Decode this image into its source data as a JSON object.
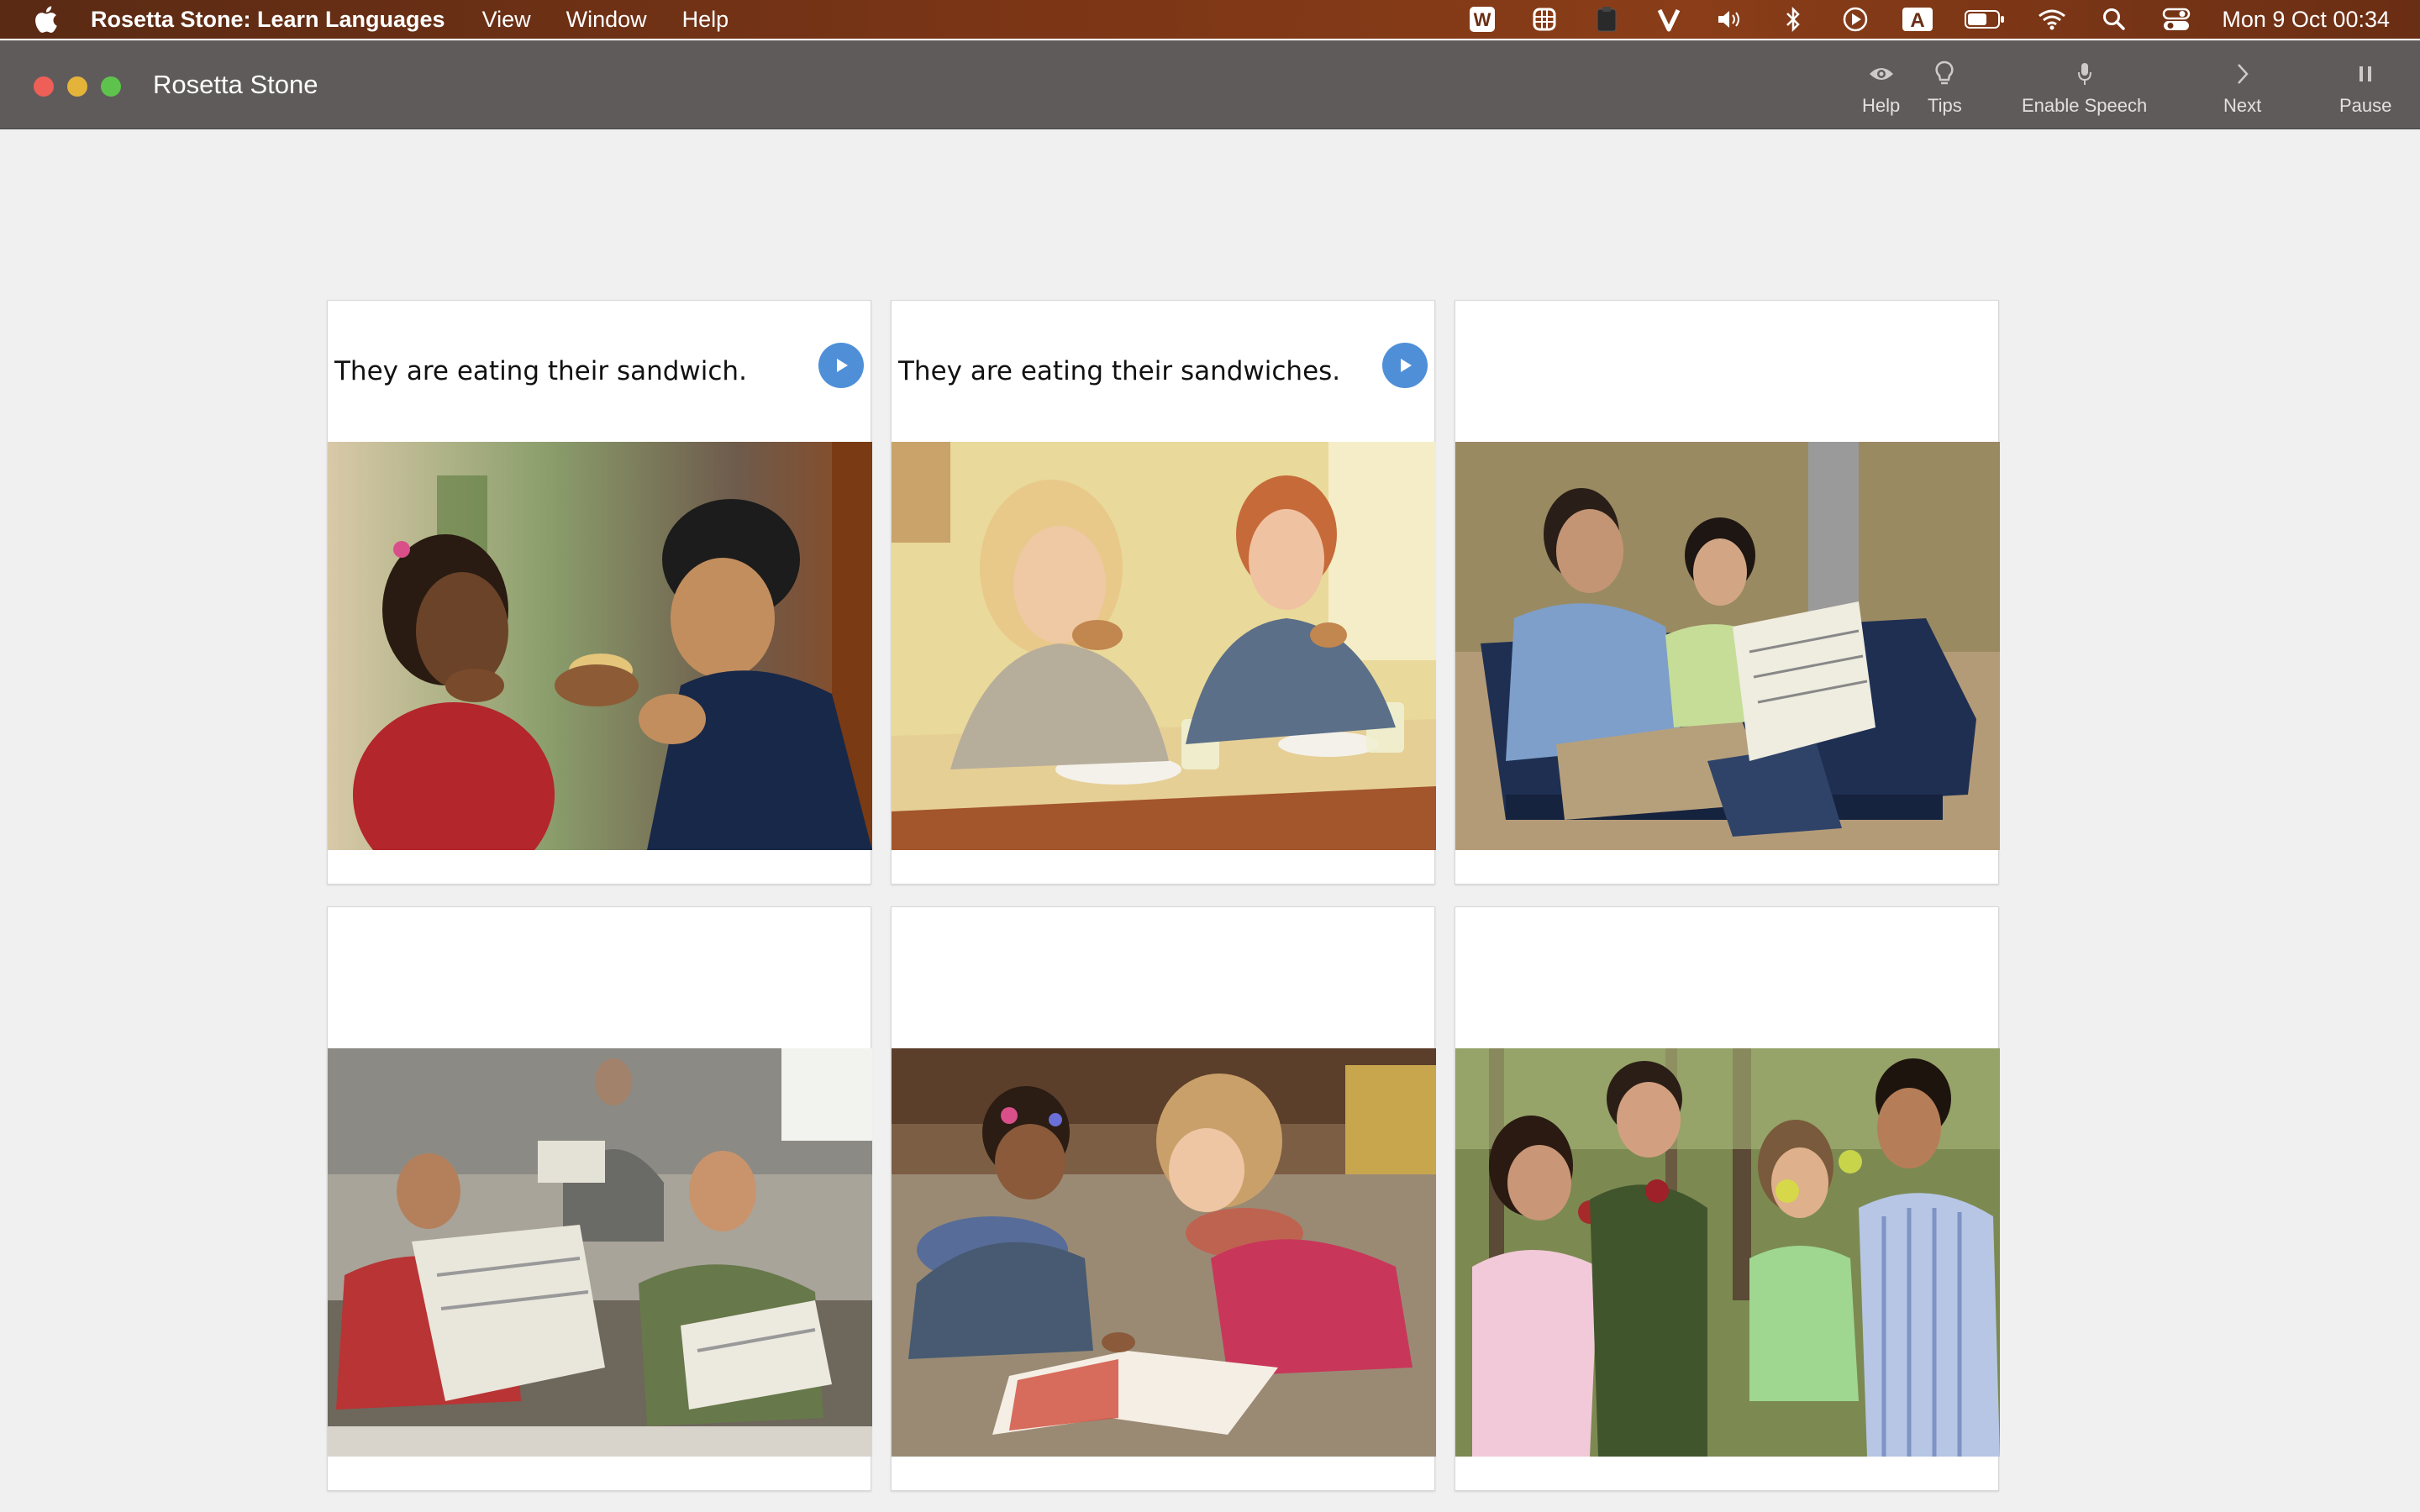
{
  "menubar": {
    "app_name": "Rosetta Stone: Learn Languages",
    "items": [
      "View",
      "Window",
      "Help"
    ],
    "status_icons": [
      "word-icon",
      "grid-icon",
      "clipboard-icon",
      "vivaldi-icon",
      "volume-icon",
      "bluetooth-icon",
      "play-circle-icon",
      "keyboard-input-icon",
      "battery-icon",
      "wifi-icon",
      "spotlight-search-icon",
      "control-center-icon"
    ],
    "input_source_label": "A",
    "clock": "Mon 9 Oct  00:34"
  },
  "window": {
    "title": "Rosetta Stone",
    "toolbar": {
      "help": "Help",
      "tips": "Tips",
      "speech": "Enable Speech",
      "next": "Next",
      "pause": "Pause"
    }
  },
  "cards": [
    {
      "caption": "They are eating their sandwich.",
      "has_audio": true,
      "photo": "girl and boy eating sandwich"
    },
    {
      "caption": "They are eating their sandwiches.",
      "has_audio": true,
      "photo": "two girls eating sandwiches at table"
    },
    {
      "caption": "",
      "has_audio": false,
      "photo": "couple on bench reading newspaper"
    },
    {
      "caption": "",
      "has_audio": false,
      "photo": "men reading newspapers"
    },
    {
      "caption": "",
      "has_audio": false,
      "photo": "two girls reading a book"
    },
    {
      "caption": "",
      "has_audio": false,
      "photo": "group eating apples outdoors"
    }
  ],
  "colors": {
    "play_button": "#4f8fd8",
    "titlebar": "#5f5b5b",
    "background": "#f0f0f0"
  }
}
